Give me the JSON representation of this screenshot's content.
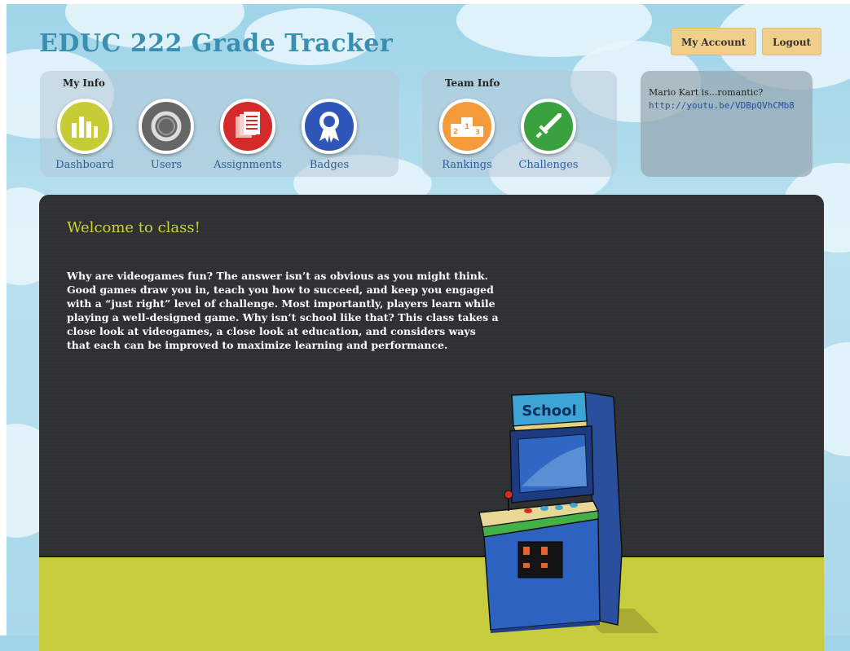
{
  "app": {
    "title": "EDUC 222 Grade Tracker"
  },
  "header": {
    "my_account_label": "My Account",
    "logout_label": "Logout"
  },
  "my_info": {
    "label": "My Info",
    "items": [
      {
        "label": "Dashboard",
        "icon": "bar-chart-icon",
        "color": "#c5cc36"
      },
      {
        "label": "Users",
        "icon": "ring-icon",
        "color": "#666666"
      },
      {
        "label": "Assignments",
        "icon": "document-stack-icon",
        "color": "#d42a2a"
      },
      {
        "label": "Badges",
        "icon": "ribbon-badge-icon",
        "color": "#2f57b8"
      }
    ]
  },
  "team_info": {
    "label": "Team Info",
    "items": [
      {
        "label": "Rankings",
        "icon": "podium-icon",
        "color": "#f39a3a"
      },
      {
        "label": "Challenges",
        "icon": "sword-icon",
        "color": "#3aa13f"
      }
    ]
  },
  "status": {
    "text": "Mario Kart is...romantic?",
    "link": "http://youtu.be/VDBpQVhCMb8"
  },
  "main": {
    "heading": "Welcome to class!",
    "intro": "Why are videogames fun? The answer isn’t as obvious as you might think. Good games draw you in, teach you how to succeed, and keep you engaged with a “just right” level of challenge. Most importantly, players learn while playing a well-designed game. Why isn’t school like that? This class takes a close look at videogames, a close look at education, and considers ways that each can be improved to maximize learning and performance.",
    "arcade_sign": "School"
  },
  "colors": {
    "accent_title": "#3a8fb0",
    "welcome": "#c9d23a",
    "button": "#f0cf8a",
    "panel_dark": "#2f3033",
    "floor": "#c8cc3f"
  }
}
